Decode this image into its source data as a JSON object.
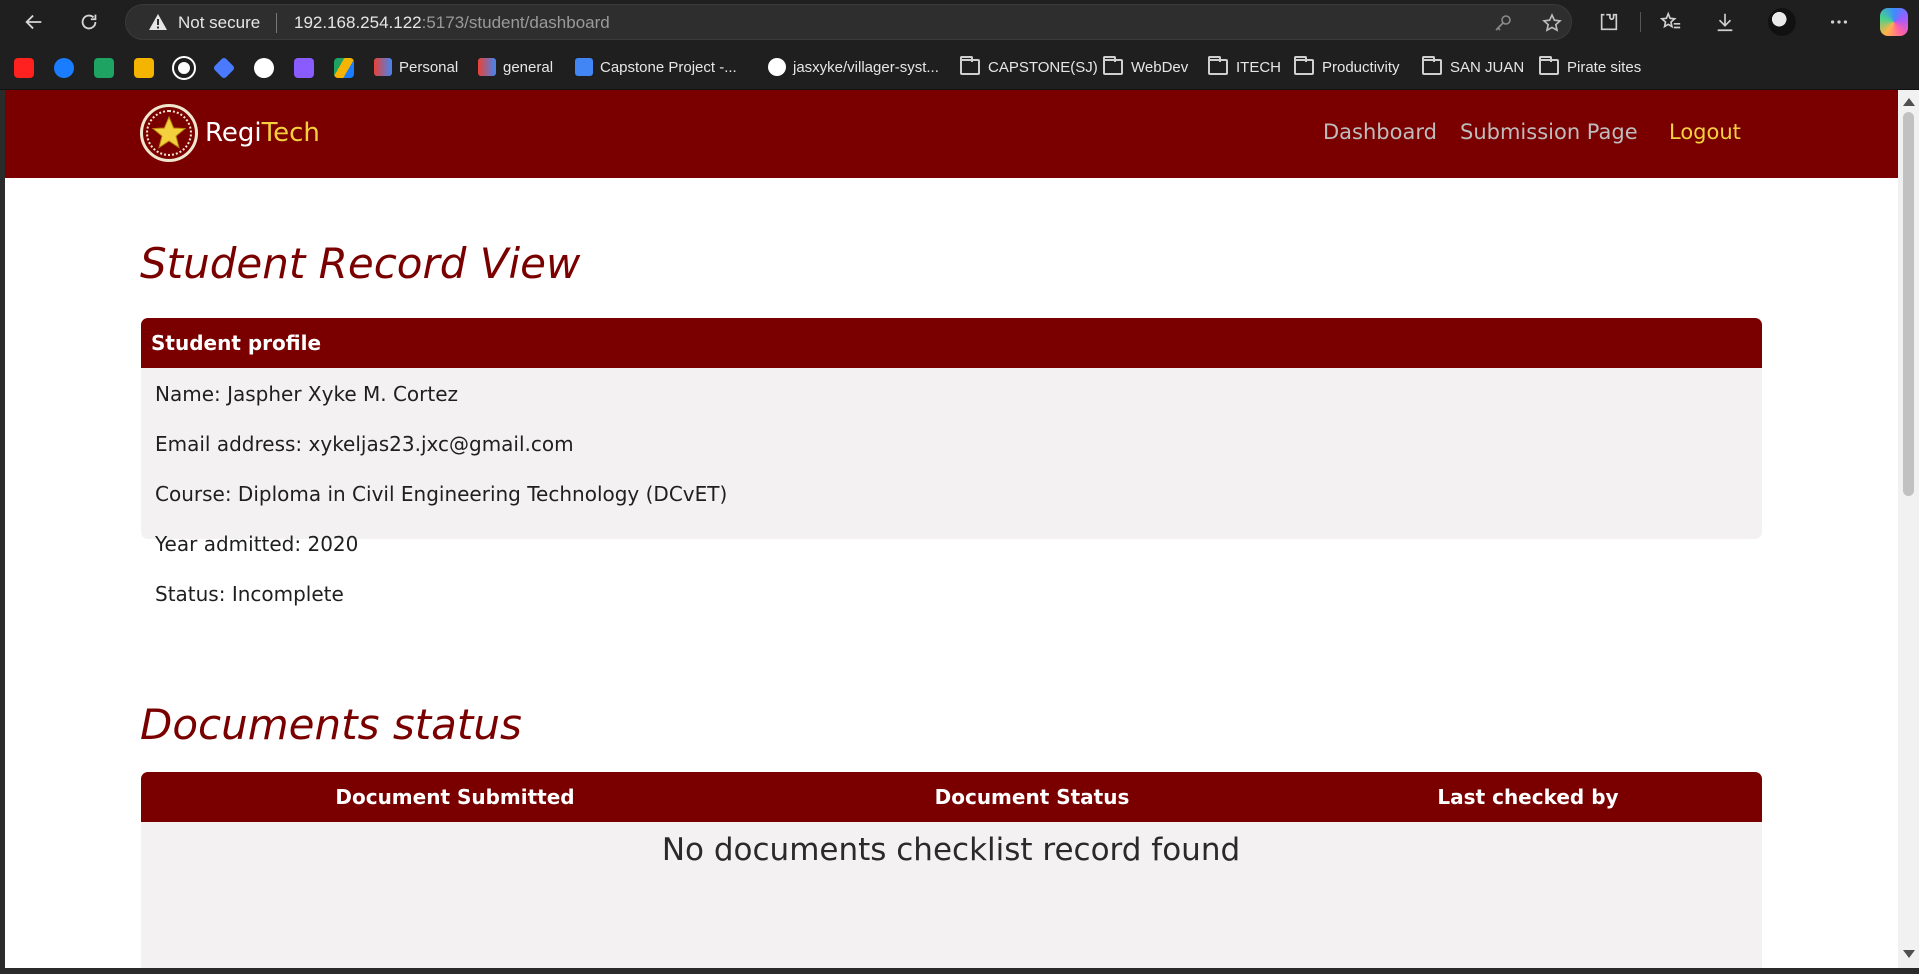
{
  "browser": {
    "security_label": "Not secure",
    "url_host": "192.168.254.122",
    "url_path": ":5173/student/dashboard",
    "bookmarks": [
      "Personal",
      "general",
      "Capstone Project -...",
      "jasxyke/villager-syst...",
      "CAPSTONE(SJ)",
      "WebDev",
      "ITECH",
      "Productivity",
      "SAN JUAN",
      "Pirate sites"
    ]
  },
  "site": {
    "brand_main": "Regi",
    "brand_accent": "Tech",
    "nav": {
      "dashboard": "Dashboard",
      "submission": "Submission Page",
      "logout": "Logout"
    },
    "colors": {
      "primary": "#7a0000",
      "accent": "#f4d03f"
    }
  },
  "record": {
    "title": "Student Record View",
    "profile_header": "Student profile",
    "name": "Name: Jaspher Xyke M. Cortez",
    "email": "Email address: xykeljas23.jxc@gmail.com",
    "course": "Course: Diploma in Civil Engineering Technology (DCvET)",
    "year": "Year admitted: 2020",
    "status": "Status: Incomplete"
  },
  "documents": {
    "title": "Documents status",
    "columns": [
      "Document Submitted",
      "Document Status",
      "Last checked by"
    ],
    "empty_message": "No documents checklist record found"
  }
}
